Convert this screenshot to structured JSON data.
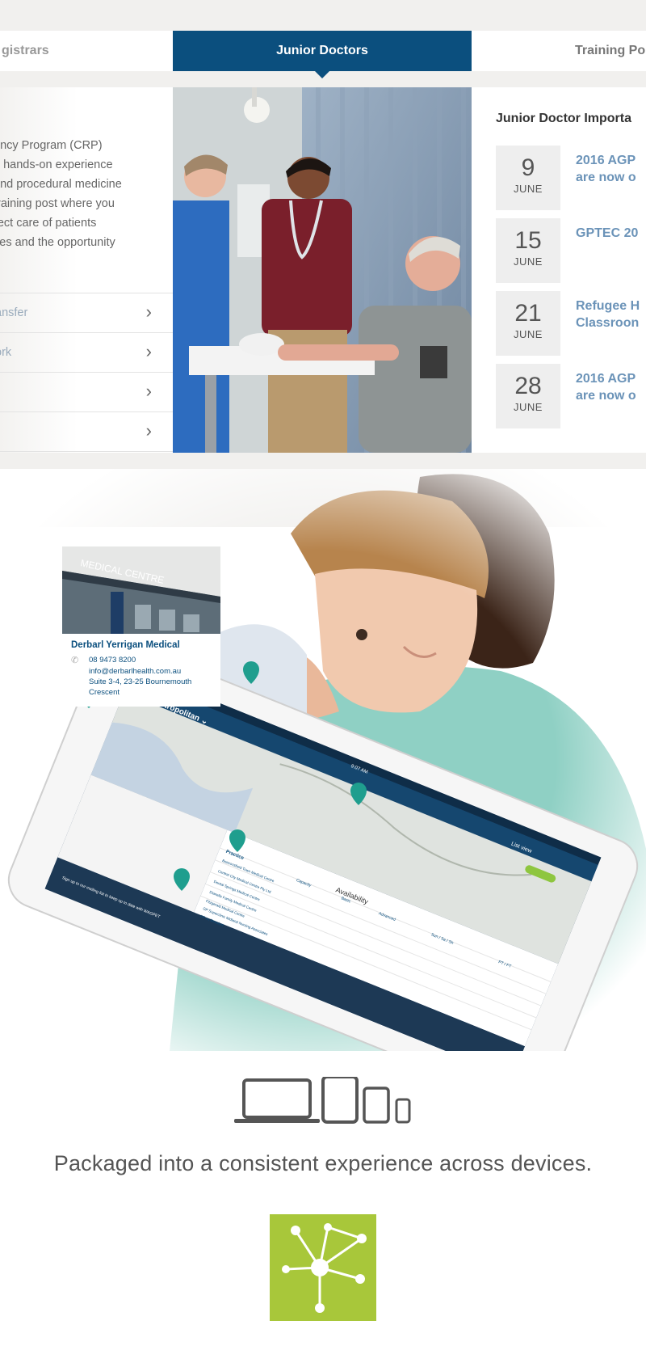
{
  "tabs": {
    "left_label": "gistrars",
    "active_label": "Junior Doctors",
    "right_label": "Training Po"
  },
  "left_panel": {
    "paragraph_lines": [
      "ency Program (CRP)",
      "u hands-on experience",
      " and procedural medicine",
      " training post where you",
      "rect care of patients",
      "ties and the opportunity"
    ],
    "menu_items": [
      {
        "label": "ansfer"
      },
      {
        "label": "ork"
      },
      {
        "label": ""
      },
      {
        "label": ""
      }
    ]
  },
  "right_panel": {
    "title": "Junior Doctor Importa",
    "events": [
      {
        "day": "9",
        "month": "JUNE",
        "line1": "2016 AGP",
        "line2": "are now o"
      },
      {
        "day": "15",
        "month": "JUNE",
        "line1": "GPTEC 20",
        "line2": ""
      },
      {
        "day": "21",
        "month": "JUNE",
        "line1": "Refugee H",
        "line2": "Classroon"
      },
      {
        "day": "28",
        "month": "JUNE",
        "line1": "2016 AGP",
        "line2": "are now o"
      }
    ]
  },
  "clinic_card": {
    "image_sign": "MEDICAL CENTRE",
    "name": "Derbarl Yerrigan Medical",
    "phone": "08 9473 8200",
    "email": "info@derbarlhealth.com.au",
    "address_line1": "Suite 3-4, 23-25 Bournemouth",
    "address_line2": "Crescent"
  },
  "tablet": {
    "status_time": "9:07 AM",
    "region_label": "East Metropolitan",
    "list_view_label": "List view",
    "availability_heading": "Availability",
    "practice_header": "Practice",
    "columns": [
      "Capacity",
      "Basic",
      "Advanced",
      "Sun / Sa / Sh",
      "PT / FT"
    ],
    "practices": [
      "Beaconsfield Town Medical Centre",
      "Central City Medical Centre Pty Ltd",
      "Dental Springs Medical Centre",
      "Dianella Family Medical Centre",
      "Fitzgerald Medical Centre",
      "GP Superclinic Midland Nursing Associates",
      "GP on Beaufort"
    ],
    "footer_text": "Sign up to our mailing list to keep up to date with WAGPET"
  },
  "tagline": "Packaged into a consistent experience across devices.",
  "icons": [
    "laptop-icon",
    "tablet-icon",
    "small-tablet-icon",
    "phone-icon",
    "network-logo"
  ],
  "colors": {
    "brand_blue": "#0b4f7e",
    "accent_green": "#a8c73a",
    "pin_teal": "#1f9e8e"
  }
}
